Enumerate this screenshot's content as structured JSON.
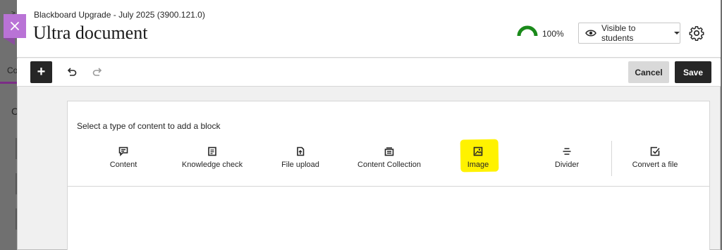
{
  "background": {
    "tab_text": "Co",
    "left_letter": "C",
    "top_glyph": "≥"
  },
  "header": {
    "close_icon": "close-icon",
    "subtitle": "Blackboard Upgrade - July 2025 (3900.121.0)",
    "title": "Ultra document",
    "progress": {
      "label": "100%",
      "value_percent": 100,
      "color": "#1a8a1a"
    },
    "visibility": {
      "label": "Visible to students",
      "icon": "eye-icon"
    },
    "settings_icon": "gear-icon"
  },
  "toolbar": {
    "add_label": "+",
    "cancel_label": "Cancel",
    "save_label": "Save"
  },
  "block_picker": {
    "heading": "Select a type of content to add a block",
    "options": [
      {
        "label": "Content",
        "icon": "content-icon"
      },
      {
        "label": "Knowledge check",
        "icon": "knowledge-check-icon"
      },
      {
        "label": "File upload",
        "icon": "file-upload-icon"
      },
      {
        "label": "Content Collection",
        "icon": "content-collection-icon"
      },
      {
        "label": "Image",
        "icon": "image-icon",
        "highlighted": true
      },
      {
        "label": "Divider",
        "icon": "divider-icon"
      },
      {
        "label": "Convert a file",
        "icon": "convert-file-icon"
      }
    ],
    "highlight_color": "#fff200"
  }
}
